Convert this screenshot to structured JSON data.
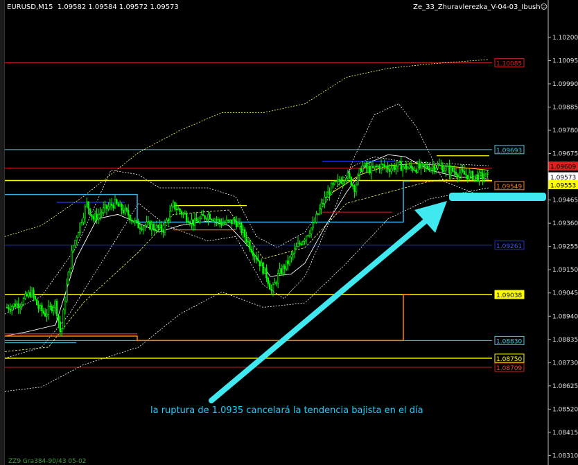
{
  "header": {
    "symbol": "EURUSD,M15",
    "ohlc": "1.09582 1.09584 1.09572 1.09573",
    "indicator": "Ze_33_Zhuravlerezka_V-04-03_Ibush☺"
  },
  "bottom_info": "ZZ9 Gra384-90/43 05-02",
  "annotation": "la ruptura de 1.0935 cancelará la tendencia bajista en el día",
  "colors": {
    "candle": "#00ff00",
    "level_red": "#d02020",
    "level_cyan": "#40d0e0",
    "level_blue": "#2030d0",
    "level_yellow": "#ffff00",
    "level_orange": "#ff8000",
    "arrow": "#40e8f0"
  },
  "chart_data": {
    "type": "line",
    "title": "",
    "xlabel": "",
    "ylabel": "",
    "ylim": [
      1.0828,
      1.103
    ],
    "yticks": [
      "1.10200",
      "1.10095",
      "1.09990",
      "1.09885",
      "1.09780",
      "1.09675",
      "1.09570",
      "1.09465",
      "1.09360",
      "1.09255",
      "1.09150",
      "1.09045",
      "1.08940",
      "1.08835",
      "1.08730",
      "1.08625",
      "1.08520",
      "1.08415",
      "1.08310"
    ],
    "levels": [
      {
        "label": "1.10085",
        "value": 1.10085,
        "color": "#d02020",
        "badge_text": "#d02020"
      },
      {
        "label": "1.09693",
        "value": 1.09693,
        "color": "#40d0e0",
        "badge_text": "#40d0e0"
      },
      {
        "label": "1.09609",
        "value": 1.09609,
        "color": "#d02020",
        "badge_fill": "#e02020"
      },
      {
        "label": "1.09573",
        "value": 1.09573,
        "color": "#808080",
        "badge_fill": "#ffffff"
      },
      {
        "label": "1.09553",
        "value": 1.09553,
        "color": "#ffff00",
        "badge_fill": "#ffff00"
      },
      {
        "label": "1.09549",
        "value": 1.09549,
        "color": "#ff8000",
        "badge_text": "#ff8000"
      },
      {
        "label": "1.09261",
        "value": 1.09261,
        "color": "#2030d0",
        "badge_text": "#4050ff"
      },
      {
        "label": "1.09038",
        "value": 1.09038,
        "color": "#ffff00",
        "badge_fill": "#ffff00"
      },
      {
        "label": "1.08830",
        "value": 1.0883,
        "color": "#40d0e0",
        "badge_text": "#40d0e0"
      },
      {
        "label": "1.08750",
        "value": 1.0875,
        "color": "#ffff00",
        "badge_text": "#ffff00"
      },
      {
        "label": "1.08709",
        "value": 1.08709,
        "color": "#d02020",
        "badge_text": "#ff4040"
      }
    ],
    "grid": false,
    "legend": "none"
  }
}
